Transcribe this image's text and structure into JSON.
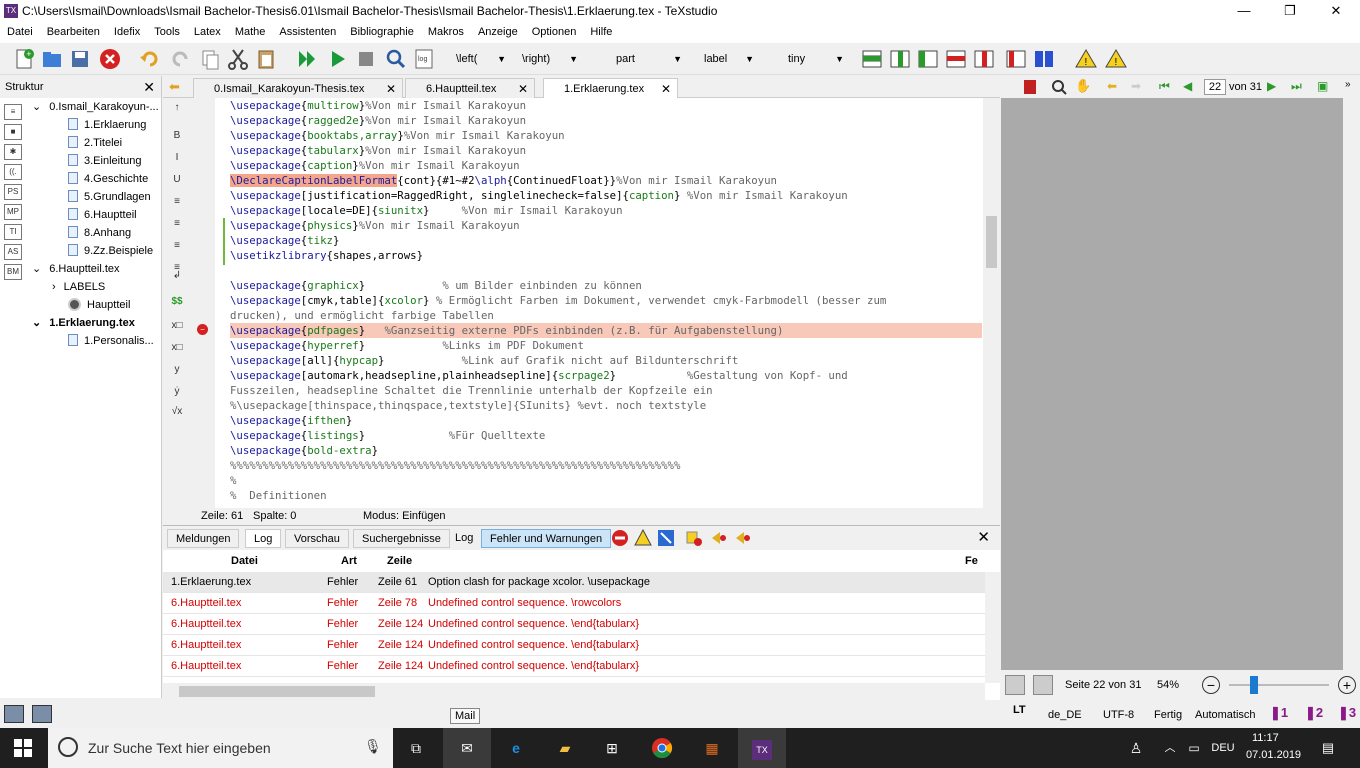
{
  "window": {
    "title": "C:\\Users\\Ismail\\Downloads\\Ismail Bachelor-Thesis6.01\\Ismail Bachelor-Thesis\\Ismail Bachelor-Thesis\\1.Erklaerung.tex - TeXstudio",
    "minimize": "—",
    "maximize": "❐",
    "close": "✕"
  },
  "menu": [
    "Datei",
    "Bearbeiten",
    "Idefix",
    "Tools",
    "Latex",
    "Mathe",
    "Assistenten",
    "Bibliographie",
    "Makros",
    "Anzeige",
    "Optionen",
    "Hilfe"
  ],
  "toolbar": {
    "left_combo": "\\left(",
    "right_combo": "\\right)",
    "part_combo": "part",
    "label_combo": "label",
    "size_combo": "tiny"
  },
  "structure": {
    "title": "Struktur",
    "close": "✕",
    "side_icons": [
      "≡",
      "■",
      "✱",
      "((.",
      "PS",
      "MP",
      "TI",
      "AS",
      "BM"
    ],
    "tree": [
      {
        "label": "0.Ismail_Karakoyun-...",
        "level": 0,
        "expand": "⌄"
      },
      {
        "label": "1.Erklaerung",
        "level": 1
      },
      {
        "label": "2.Titelei",
        "level": 1
      },
      {
        "label": "3.Einleitung",
        "level": 1
      },
      {
        "label": "4.Geschichte",
        "level": 1
      },
      {
        "label": "5.Grundlagen",
        "level": 1
      },
      {
        "label": "6.Hauptteil",
        "level": 1
      },
      {
        "label": "8.Anhang",
        "level": 1
      },
      {
        "label": "9.Zz.Beispiele",
        "level": 1
      },
      {
        "label": "6.Hauptteil.tex",
        "level": 0,
        "expand": "⌄"
      },
      {
        "label": "LABELS",
        "level": 1,
        "expand": "›"
      },
      {
        "label": "Hauptteil",
        "level": 2
      },
      {
        "label": "1.Erklaerung.tex",
        "level": 0,
        "expand": "⌄",
        "bold": true
      },
      {
        "label": "1.Personalis...",
        "level": 1
      }
    ]
  },
  "tabs": [
    {
      "label": "0.Ismail_Karakoyun-Thesis.tex"
    },
    {
      "label": "6.Hauptteil.tex"
    },
    {
      "label": "1.Erklaerung.tex",
      "active": true
    }
  ],
  "editor_lines": [
    [
      [
        "kw",
        "\\usepackage"
      ],
      [
        "t",
        "{"
      ],
      [
        "arg",
        "multirow"
      ],
      [
        "t",
        "}"
      ],
      [
        "cm",
        "%Von mir Ismail Karakoyun"
      ]
    ],
    [
      [
        "kw",
        "\\usepackage"
      ],
      [
        "t",
        "{"
      ],
      [
        "arg",
        "ragged2e"
      ],
      [
        "t",
        "}"
      ],
      [
        "cm",
        "%Von mir Ismail Karakoyun"
      ]
    ],
    [
      [
        "kw",
        "\\usepackage"
      ],
      [
        "t",
        "{"
      ],
      [
        "arg",
        "booktabs,array"
      ],
      [
        "t",
        "}"
      ],
      [
        "cm",
        "%Von mir Ismail Karakoyun"
      ]
    ],
    [
      [
        "kw",
        "\\usepackage"
      ],
      [
        "t",
        "{"
      ],
      [
        "arg",
        "tabularx"
      ],
      [
        "t",
        "}"
      ],
      [
        "cm",
        "%Von mir Ismail Karakoyun"
      ]
    ],
    [
      [
        "kw",
        "\\usepackage"
      ],
      [
        "t",
        "{"
      ],
      [
        "arg",
        "caption"
      ],
      [
        "t",
        "}"
      ],
      [
        "cm",
        "%Von mir Ismail Karakoyun"
      ]
    ],
    [
      [
        "hk",
        "\\DeclareCaptionLabelFormat"
      ],
      [
        "t",
        "{cont}{#1~#2"
      ],
      [
        "kw",
        "\\alph"
      ],
      [
        "t",
        "{ContinuedFloat}}"
      ],
      [
        "cm",
        "%Von mir Ismail Karakoyun"
      ]
    ],
    [
      [
        "kw",
        "\\usepackage"
      ],
      [
        "t",
        "[justification=RaggedRight, singlelinecheck=false]{"
      ],
      [
        "arg",
        "caption"
      ],
      [
        "t",
        "} "
      ],
      [
        "cm",
        "%Von mir Ismail Karakoyun"
      ]
    ],
    [
      [
        "kw",
        "\\usepackage"
      ],
      [
        "t",
        "[locale=DE]{"
      ],
      [
        "arg",
        "siunitx"
      ],
      [
        "t",
        "}     "
      ],
      [
        "cm",
        "%Von mir Ismail Karakoyun"
      ]
    ],
    [
      [
        "kw",
        "\\usepackage"
      ],
      [
        "t",
        "{"
      ],
      [
        "arg",
        "physics"
      ],
      [
        "t",
        "}"
      ],
      [
        "cm",
        "%Von mir Ismail Karakoyun"
      ]
    ],
    [
      [
        "kw",
        "\\usepackage"
      ],
      [
        "t",
        "{"
      ],
      [
        "arg",
        "tikz"
      ],
      [
        "t",
        "}"
      ]
    ],
    [
      [
        "kw",
        "\\usetikzlibrary"
      ],
      [
        "t",
        "{shapes,arrows}"
      ]
    ],
    [],
    [
      [
        "kw",
        "\\usepackage"
      ],
      [
        "t",
        "{"
      ],
      [
        "arg",
        "graphicx"
      ],
      [
        "t",
        "}            "
      ],
      [
        "cm",
        "% um Bilder einbinden zu können"
      ]
    ],
    [
      [
        "kw",
        "\\usepackage"
      ],
      [
        "t",
        "[cmyk,table]{"
      ],
      [
        "arg",
        "xcolor"
      ],
      [
        "t",
        "} "
      ],
      [
        "cm",
        "% Ermöglicht Farben im Dokument, verwendet cmyk-Farbmodell (besser zum"
      ]
    ],
    [
      [
        "cm",
        "drucken), und ermöglicht farbige Tabellen"
      ]
    ],
    [
      [
        "kw",
        "\\usepackage"
      ],
      [
        "t",
        "{"
      ],
      [
        "arg",
        "pdfpages"
      ],
      [
        "t",
        "}   "
      ],
      [
        "cm",
        "%Ganzseitig externe PDFs einbinden (z.B. für Aufgabenstellung)"
      ]
    ],
    [
      [
        "kw",
        "\\usepackage"
      ],
      [
        "t",
        "{"
      ],
      [
        "arg",
        "hyperref"
      ],
      [
        "t",
        "}            "
      ],
      [
        "cm",
        "%Links im PDF Dokument"
      ]
    ],
    [
      [
        "kw",
        "\\usepackage"
      ],
      [
        "t",
        "[all]{"
      ],
      [
        "arg",
        "hypcap"
      ],
      [
        "t",
        "}            "
      ],
      [
        "cm",
        "%Link auf Grafik nicht auf Bildunterschrift"
      ]
    ],
    [
      [
        "kw",
        "\\usepackage"
      ],
      [
        "t",
        "[automark,headsepline,plainheadsepline]{"
      ],
      [
        "arg",
        "scrpage2"
      ],
      [
        "t",
        "}           "
      ],
      [
        "cm",
        "%Gestaltung von Kopf- und"
      ]
    ],
    [
      [
        "cm",
        "Fusszeilen, headsepline Schaltet die Trennlinie unterhalb der Kopfzeile ein"
      ]
    ],
    [
      [
        "cm",
        "%\\usepackage[thinspace,thinqspace,textstyle]{SIunits} %evt. noch textstyle"
      ]
    ],
    [
      [
        "kw",
        "\\usepackage"
      ],
      [
        "t",
        "{"
      ],
      [
        "arg",
        "ifthen"
      ],
      [
        "t",
        "}"
      ]
    ],
    [
      [
        "kw",
        "\\usepackage"
      ],
      [
        "t",
        "{"
      ],
      [
        "arg",
        "listings"
      ],
      [
        "t",
        "}             "
      ],
      [
        "cm",
        "%Für Quelltexte"
      ]
    ],
    [
      [
        "kw",
        "\\usepackage"
      ],
      [
        "t",
        "{"
      ],
      [
        "arg",
        "bold-extra"
      ],
      [
        "t",
        "}"
      ]
    ],
    [
      [
        "cm",
        "%%%%%%%%%%%%%%%%%%%%%%%%%%%%%%%%%%%%%%%%%%%%%%%%%%%%%%%%%%%%%%%%%%%%%%"
      ]
    ],
    [
      [
        "cm",
        "%"
      ]
    ],
    [
      [
        "cm",
        "%  Definitionen"
      ]
    ]
  ],
  "editor_margin_icons": [
    "↑",
    "B",
    "I",
    "U",
    "≡",
    "≡",
    "≡",
    "≡",
    "↲",
    "$$",
    "x□",
    "x□",
    "y",
    "ẏ",
    "√x"
  ],
  "status": {
    "line": "Zeile: 61",
    "column": "Spalte: 0",
    "mode": "Modus: Einfügen"
  },
  "messages": {
    "tabs": [
      "Meldungen",
      "Log",
      "Vorschau",
      "Suchergebnisse"
    ],
    "log_label": "Log",
    "filter_label": "Fehler und Warnungen",
    "close": "✕",
    "headers": {
      "file": "Datei",
      "type": "Art",
      "line": "Zeile",
      "message": "Fe"
    },
    "rows": [
      {
        "file": "1.Erklaerung.tex",
        "type": "Fehler",
        "line": "Zeile 61",
        "message": "Option clash for package xcolor. \\usepackage",
        "selected": true
      },
      {
        "file": "6.Hauptteil.tex",
        "type": "Fehler",
        "line": "Zeile 78",
        "message": "Undefined control sequence. \\rowcolors"
      },
      {
        "file": "6.Hauptteil.tex",
        "type": "Fehler",
        "line": "Zeile 124",
        "message": "Undefined control sequence. \\end{tabularx}"
      },
      {
        "file": "6.Hauptteil.tex",
        "type": "Fehler",
        "line": "Zeile 124",
        "message": "Undefined control sequence. \\end{tabularx}"
      },
      {
        "file": "6.Hauptteil.tex",
        "type": "Fehler",
        "line": "Zeile 124",
        "message": "Undefined control sequence. \\end{tabularx}"
      }
    ]
  },
  "pdf": {
    "page_input": "22",
    "page_total": "von 31",
    "page_status": "Seite 22 von 31",
    "zoom": "54%"
  },
  "bottom": {
    "tooltip": "Mail",
    "language": "de_DE",
    "encoding": "UTF-8",
    "ready": "Fertig",
    "compile": "Automatisch"
  },
  "taskbar": {
    "search_placeholder": "Zur Suche Text hier eingeben",
    "lang": "DEU",
    "time": "11:17",
    "date": "07.01.2019"
  }
}
